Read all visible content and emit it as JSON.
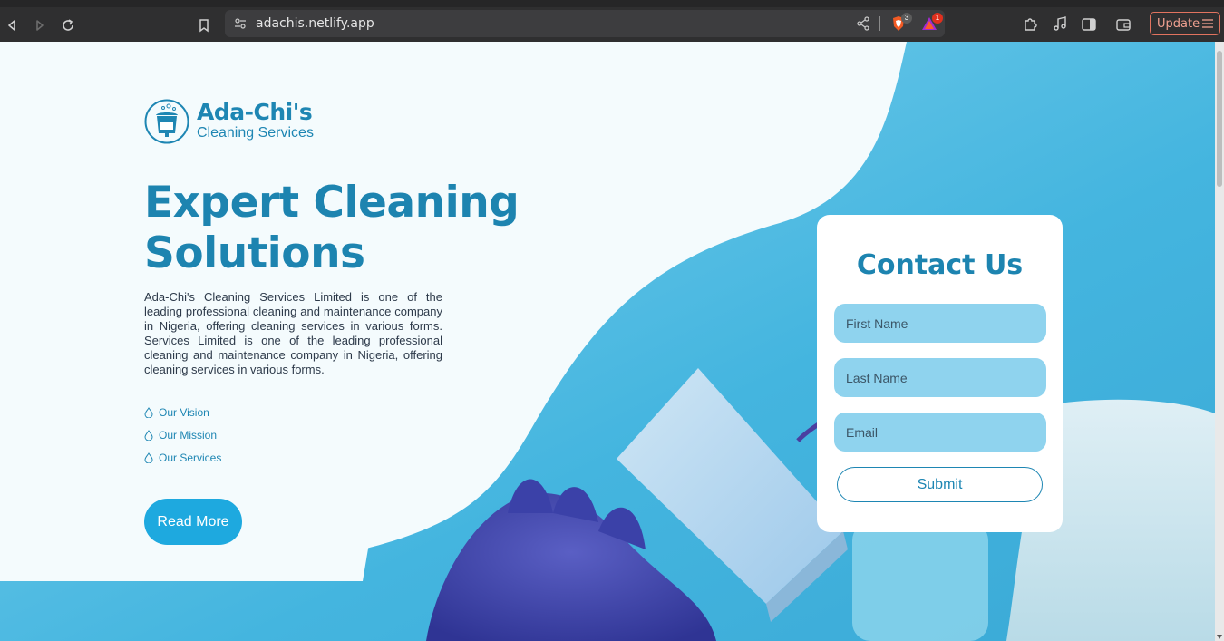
{
  "browser": {
    "url": "adachis.netlify.app",
    "shield_count": "3",
    "rewards_count": "1",
    "update_label": "Update"
  },
  "logo": {
    "name": "Ada-Chi's",
    "tagline": "Cleaning Services"
  },
  "hero": {
    "title_line1": "Expert Cleaning",
    "title_line2": "Solutions",
    "description": "Ada-Chi's Cleaning Services Limited is one of the leading professional cleaning and maintenance company in Nigeria, offering cleaning services in various forms. Services Limited is one of the leading professional cleaning and maintenance company in Nigeria, offering cleaning services in various forms.",
    "links": [
      "Our Vision",
      "Our Mission",
      "Our Services"
    ],
    "read_more": "Read More"
  },
  "contact": {
    "title": "Contact Us",
    "first_name_placeholder": "First Name",
    "last_name_placeholder": "Last Name",
    "email_placeholder": "Email",
    "submit_label": "Submit"
  },
  "colors": {
    "brand_blue": "#1d84b0",
    "button_blue": "#1ea9df",
    "field_bg": "#8fd3ee",
    "page_bg": "#4fbde2"
  }
}
